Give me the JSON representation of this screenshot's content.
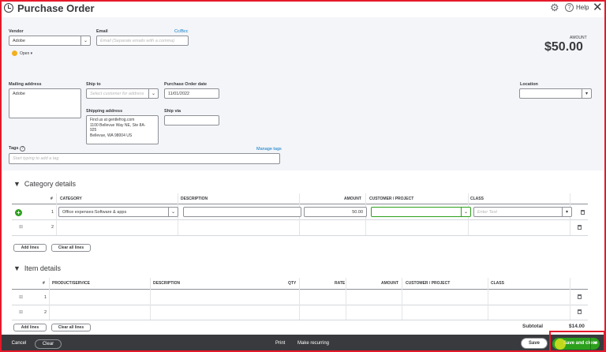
{
  "header": {
    "title": "Purchase Order",
    "help": "Help",
    "close": "✕"
  },
  "form": {
    "vendor_label": "Vendor",
    "vendor_value": "Adobe",
    "email_label": "Email",
    "email_placeholder": "Email (Separate emails with a comma)",
    "ccbcc": "Cc/Bcc",
    "status": "Open ▾",
    "amount_label": "AMOUNT",
    "amount_value": "$50.00",
    "mailing_label": "Mailing address",
    "mailing_value": "Adobe",
    "shipto_label": "Ship to",
    "shipto_placeholder": "Select customer for address",
    "po_date_label": "Purchase Order date",
    "po_date_value": "11/01/2022",
    "location_label": "Location",
    "shipping_label": "Shipping address",
    "shipping_lines": [
      "Find us at gentlefrog.com",
      "1100 Bellevue Way NE, Ste 8A-",
      "925",
      "Bellevue, WA 98004 US"
    ],
    "shipvia_label": "Ship via",
    "tags_label": "Tags",
    "manage_tags": "Manage tags",
    "tags_placeholder": "Start typing to add a tag"
  },
  "category": {
    "title": "Category details",
    "columns": [
      "#",
      "CATEGORY",
      "DESCRIPTION",
      "AMOUNT",
      "CUSTOMER / PROJECT",
      "CLASS"
    ],
    "rows": [
      {
        "num": "1",
        "category": "Office expenses:Software & apps",
        "amount": "50.00",
        "class_placeholder": "Enter Text"
      },
      {
        "num": "2",
        "category": "",
        "amount": "",
        "class_placeholder": ""
      }
    ],
    "add_lines": "Add lines",
    "clear_lines": "Clear all lines"
  },
  "items": {
    "title": "Item details",
    "columns": [
      "#",
      "PRODUCT/SERVICE",
      "DESCRIPTION",
      "QTY",
      "RATE",
      "AMOUNT",
      "CUSTOMER / PROJECT",
      "CLASS"
    ],
    "rows": [
      {
        "num": "1"
      },
      {
        "num": "2"
      }
    ],
    "add_lines": "Add lines",
    "clear_lines": "Clear all lines",
    "subtotal_label": "Subtotal",
    "subtotal_value": "$14.00"
  },
  "footer": {
    "cancel": "Cancel",
    "clear": "Clear",
    "print": "Print",
    "recurring": "Make recurring",
    "save": "Save",
    "save_close": "Save and close"
  },
  "colors": {
    "accent": "#2ca01c",
    "footer": "#393a3d",
    "highlight": "#e5192b"
  }
}
